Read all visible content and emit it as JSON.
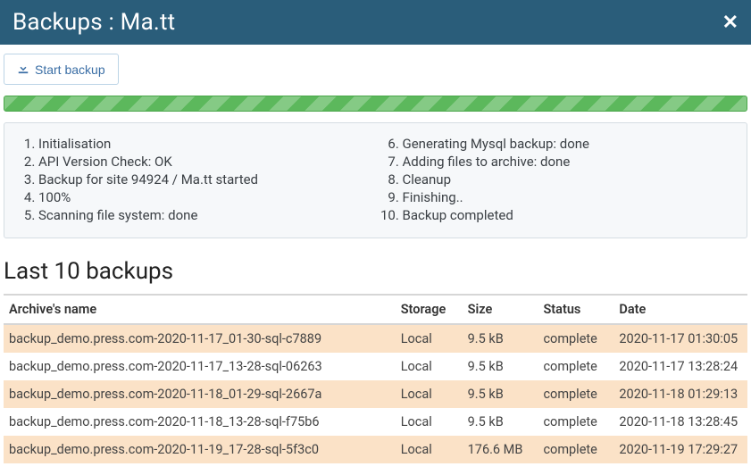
{
  "header": {
    "title": "Backups : Ma.tt"
  },
  "buttons": {
    "start_backup": "Start backup"
  },
  "log_steps": [
    "Initialisation",
    "API Version Check: OK",
    "Backup for site 94924 / Ma.tt started",
    "100%",
    "Scanning file system: done",
    "Generating Mysql backup: done",
    "Adding files to archive: done",
    "Cleanup",
    "Finishing..",
    "Backup completed"
  ],
  "section_title": "Last 10 backups",
  "columns": {
    "name": "Archive's name",
    "storage": "Storage",
    "size": "Size",
    "status": "Status",
    "date": "Date"
  },
  "rows": [
    {
      "name": "backup_demo.press.com-2020-11-17_01-30-sql-c7889",
      "storage": "Local",
      "size": "9.5 kB",
      "status": "complete",
      "date": "2020-11-17 01:30:05"
    },
    {
      "name": "backup_demo.press.com-2020-11-17_13-28-sql-06263",
      "storage": "Local",
      "size": "9.5 kB",
      "status": "complete",
      "date": "2020-11-17 13:28:24"
    },
    {
      "name": "backup_demo.press.com-2020-11-18_01-29-sql-2667a",
      "storage": "Local",
      "size": "9.5 kB",
      "status": "complete",
      "date": "2020-11-18 01:29:13"
    },
    {
      "name": "backup_demo.press.com-2020-11-18_13-28-sql-f75b6",
      "storage": "Local",
      "size": "9.5 kB",
      "status": "complete",
      "date": "2020-11-18 13:28:45"
    },
    {
      "name": "backup_demo.press.com-2020-11-19_17-28-sql-5f3c0",
      "storage": "Local",
      "size": "176.6 MB",
      "status": "complete",
      "date": "2020-11-19 17:29:27"
    }
  ]
}
